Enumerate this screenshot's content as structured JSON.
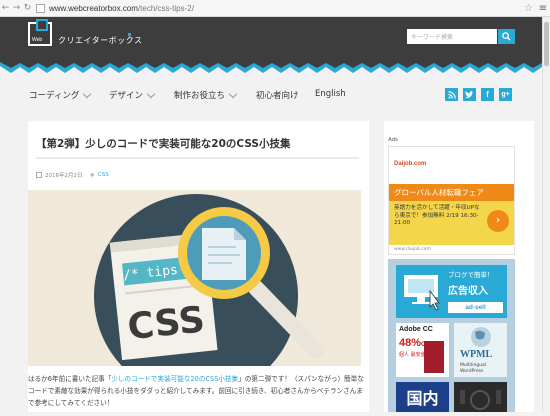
{
  "browser": {
    "url_host": "www.webcreatorbox.com",
    "url_path": "/tech/css-tips-2/"
  },
  "header": {
    "logo_label": "Web",
    "site_name": "クリエイターボックス",
    "search_placeholder": "キーワード検索"
  },
  "nav": {
    "items": [
      {
        "label": "コーディング"
      },
      {
        "label": "デザイン"
      },
      {
        "label": "制作お役立ち"
      },
      {
        "label": "初心者向け"
      },
      {
        "label": "English"
      }
    ],
    "social": [
      "rss-icon",
      "twitter-icon",
      "facebook-icon",
      "googleplus-icon"
    ],
    "accent": "#28a9d6"
  },
  "article": {
    "title": "【第2弾】少しのコードで実装可能な20のCSS小技集",
    "date": "2016年2月2日",
    "category": "CSS",
    "hero_text": "/* tips */",
    "hero_big": "CSS",
    "body_prefix": "はるか6年前に書いた記事「",
    "body_link": "少しのコードで実装可能な20のCSS小技集",
    "body_suffix": "」の第二弾です！（スパンながっ）簡単なコードで素敵な効果が得られる小技をダダっと紹介してみます。前回に引き続き、初心者さんからベテランさんまで参考にしてみてください！"
  },
  "sidebar": {
    "ads_label": "Ads",
    "ad": {
      "brand": "Daijob.com",
      "banner": "グローバル人材転職フェア",
      "desc": "英語力を活かして活躍・年収UPなら東京で！参加無料 2/19 16:30-21:00",
      "site": "www.daijob.com"
    },
    "adsell": {
      "line1": "ブログで簡単！",
      "line2": "広告収入",
      "line3": "ad-sell"
    },
    "adobe": {
      "title": "Adobe CC",
      "off": "48%",
      "off_suffix": "OFF",
      "sub": "個人 最安値"
    },
    "wpml": {
      "title": "WPML",
      "sub1": "Multilingual",
      "sub2": "WordPress"
    },
    "kokunai": "国内"
  }
}
